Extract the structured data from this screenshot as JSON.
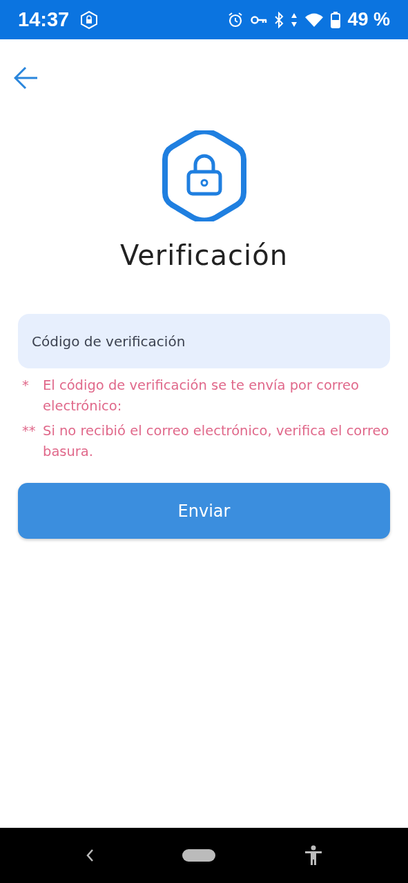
{
  "status_bar": {
    "time": "14:37",
    "battery": "49 %"
  },
  "title": "Verificación",
  "code_field": {
    "placeholder": "Código de verificación"
  },
  "notes": [
    {
      "marker": "*",
      "text": "El código de verificación se te envía por correo electrónico:"
    },
    {
      "marker": "**",
      "text": "Si no recibió el correo electrónico, verifica el correo basura."
    }
  ],
  "submit_button": {
    "label": "Enviar"
  }
}
